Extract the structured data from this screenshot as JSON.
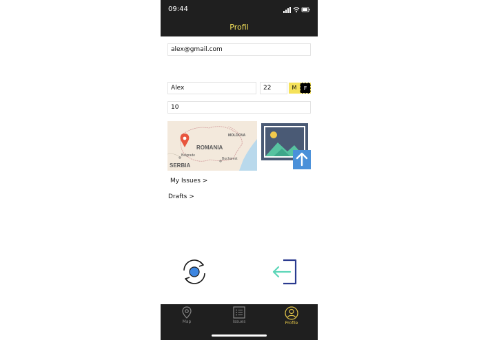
{
  "status_bar": {
    "time": "09:44"
  },
  "header": {
    "title": "Profil"
  },
  "form": {
    "email": "alex@gmail.com",
    "name": "Alex",
    "age": "22",
    "gender_male": "M",
    "gender_female": "F",
    "number": "10"
  },
  "map": {
    "country_label": "ROMANIA",
    "neighbor_label": "MOLDOVA",
    "south_label": "SERBIA",
    "city_1": "Belgrade",
    "city_2": "Bucharest"
  },
  "links": {
    "my_issues": "My Issues >",
    "drafts": "Drafts >"
  },
  "tabs": [
    {
      "label": "Map",
      "icon": "map-pin-icon",
      "active": false
    },
    {
      "label": "Issues",
      "icon": "list-icon",
      "active": false
    },
    {
      "label": "Profile",
      "icon": "person-icon",
      "active": true
    }
  ],
  "colors": {
    "accent": "#f5e25a",
    "header_bg": "#1f1f1f",
    "inactive_tab": "#8a8a8a",
    "upload_blue": "#4a90d9",
    "logout_teal": "#5cd6b8",
    "logout_navy": "#2a3a8f"
  }
}
